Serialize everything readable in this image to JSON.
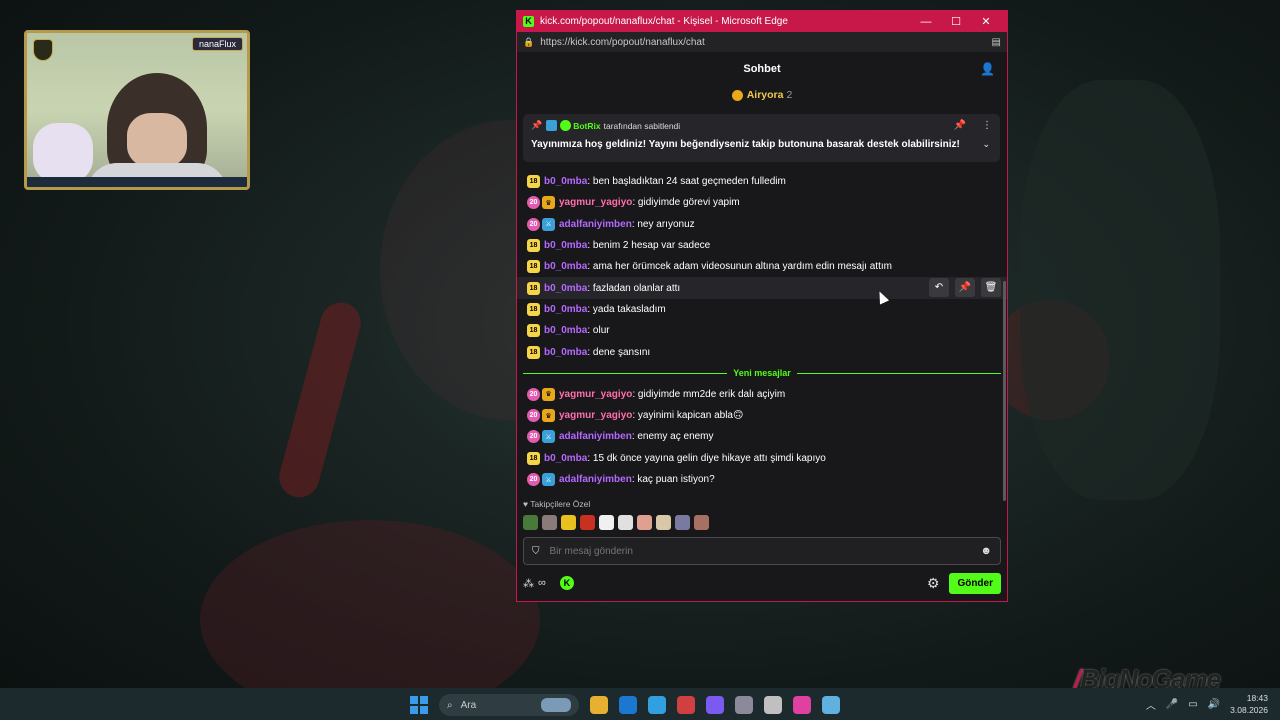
{
  "webcam": {
    "name_tag": "nanaFlux"
  },
  "window": {
    "title": "kick.com/popout/nanaflux/chat - Kişisel - Microsoft Edge",
    "url": "https://kick.com/popout/nanaflux/chat",
    "minimize": "—",
    "maximize": "☐",
    "close": "✕"
  },
  "chat": {
    "header": "Sohbet",
    "top_gifter": {
      "name": "Airyora",
      "count": "2"
    },
    "pinned": {
      "bot_name": "BotRix",
      "suffix": "tarafından sabitlendi",
      "message": "Yayınımıza hoş geldiniz! Yayını beğendiyseniz takip butonuna basarak destek olabilirsiniz!"
    },
    "messages_before": [
      {
        "badge": "18",
        "badge2": "",
        "user": "b0_0mba",
        "color": "#b468ff",
        "text": ": ben başladıktan 24 saat geçmeden fulledim"
      },
      {
        "badge": "20",
        "badge2": "crown",
        "user": "yagmur_yagiyo",
        "color": "#ff6fae",
        "text": ": gidiyimde görevi yapim"
      },
      {
        "badge": "20",
        "badge2": "sword",
        "user": "adalfaniyimben",
        "color": "#b468ff",
        "text": ": ney arıyonuz"
      },
      {
        "badge": "18",
        "badge2": "",
        "user": "b0_0mba",
        "color": "#b468ff",
        "text": ": benim 2 hesap var sadece"
      },
      {
        "badge": "18",
        "badge2": "",
        "user": "b0_0mba",
        "color": "#b468ff",
        "text": ": ama her örümcek adam videosunun altına yardım edin mesajı attım"
      },
      {
        "badge": "18",
        "badge2": "",
        "user": "b0_0mba",
        "color": "#b468ff",
        "text": ": fazladan olanlar attı",
        "hover": true
      },
      {
        "badge": "18",
        "badge2": "",
        "user": "b0_0mba",
        "color": "#b468ff",
        "text": ": yada takasladım"
      },
      {
        "badge": "18",
        "badge2": "",
        "user": "b0_0mba",
        "color": "#b468ff",
        "text": ": olur"
      },
      {
        "badge": "18",
        "badge2": "",
        "user": "b0_0mba",
        "color": "#b468ff",
        "text": ": dene şansını"
      }
    ],
    "new_messages_label": "Yeni mesajlar",
    "messages_after": [
      {
        "badge": "20",
        "badge2": "crown",
        "user": "yagmur_yagiyo",
        "color": "#ff6fae",
        "text": ": gidiyimde mm2de erik dalı açiyim"
      },
      {
        "badge": "20",
        "badge2": "crown",
        "user": "yagmur_yagiyo",
        "color": "#ff6fae",
        "text": ": yayinimi kapican abla🙃"
      },
      {
        "badge": "20",
        "badge2": "sword",
        "user": "adalfaniyimben",
        "color": "#b468ff",
        "text": ": enemy aç enemy"
      },
      {
        "badge": "18",
        "badge2": "",
        "user": "b0_0mba",
        "color": "#b468ff",
        "text": ": 15 dk önce yayına gelin diye hikaye attı şimdi kapıyo"
      },
      {
        "badge": "20",
        "badge2": "sword",
        "user": "adalfaniyimben",
        "color": "#b468ff",
        "text": ": kaç puan istiyon?"
      }
    ],
    "followers_label": "Takipçilere Özel",
    "input_placeholder": "Bir mesaj gönderin",
    "points": "∞",
    "send_label": "Gönder"
  },
  "emote_colors": [
    "#4a7a3a",
    "#8a7a7a",
    "#e8c020",
    "#c83020",
    "#f0f0f0",
    "#e0e0e0",
    "#e0a090",
    "#d8c8a8",
    "#7a7aa0",
    "#a87060"
  ],
  "watermark": "BigNoGame",
  "taskbar": {
    "search_label": "Ara",
    "time": "18:43",
    "date": "3.08.2026",
    "apps": [
      "#e8b030",
      "#1a78d0",
      "#30a0e0",
      "#d04040",
      "#7a5af0",
      "#8a8a9a",
      "#c0c0c0",
      "#e040a0",
      "#60b0e0"
    ]
  }
}
